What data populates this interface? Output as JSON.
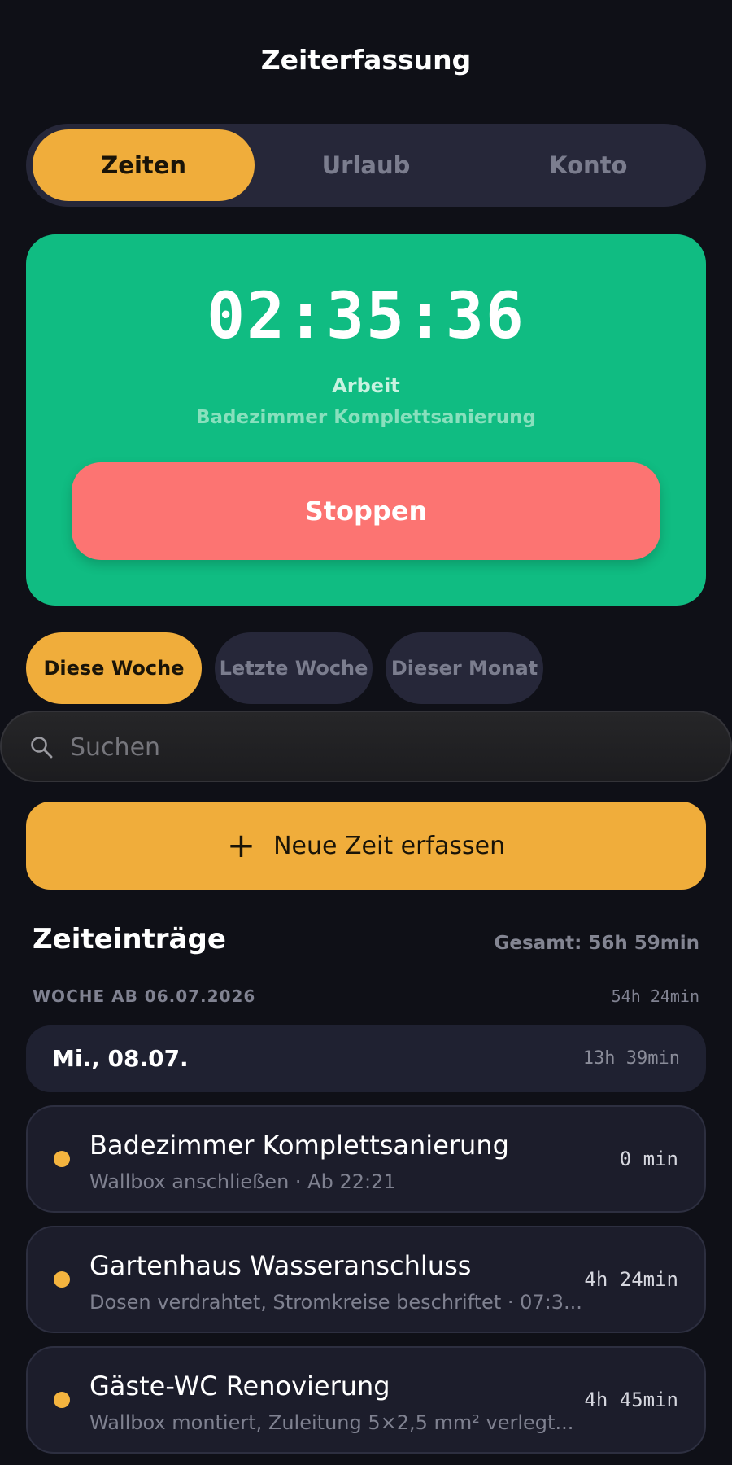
{
  "header": {
    "title": "Zeiterfassung"
  },
  "tabs": [
    {
      "label": "Zeiten",
      "active": true
    },
    {
      "label": "Urlaub",
      "active": false
    },
    {
      "label": "Konto",
      "active": false
    }
  ],
  "timer": {
    "elapsed": "02:35:36",
    "activity": "Arbeit",
    "project": "Badezimmer Komplettsanierung",
    "stop_label": "Stoppen",
    "card_color": "#10bc82",
    "stop_color": "#fc7472"
  },
  "filters": [
    {
      "label": "Diese Woche",
      "active": true
    },
    {
      "label": "Letzte Woche",
      "active": false
    },
    {
      "label": "Dieser Monat",
      "active": false
    }
  ],
  "search": {
    "placeholder": "Suchen",
    "value": ""
  },
  "add_button": {
    "icon": "plus-icon",
    "label": "Neue Zeit erfassen"
  },
  "entries_section": {
    "title": "Zeiteinträge",
    "total": "Gesamt: 56h 59min",
    "week_label": "WOCHE AB 06.07.2026",
    "week_total": "54h 24min",
    "day_label": "Mi., 08.07.",
    "day_total": "13h 39min",
    "items": [
      {
        "title": "Badezimmer Komplettsanierung",
        "subtitle": "Wallbox anschließen · Ab 22:21",
        "duration": "0 min"
      },
      {
        "title": "Gartenhaus Wasseranschluss",
        "subtitle": "Dosen verdrahtet, Stromkreise beschriftet · 07:3...",
        "duration": "4h 24min"
      },
      {
        "title": "Gäste-WC Renovierung",
        "subtitle": "Wallbox montiert, Zuleitung 5×2,5 mm² verlegt...",
        "duration": "4h 45min"
      }
    ]
  },
  "colors": {
    "accent": "#f0ad3b",
    "background": "#0f1017",
    "surface": "#262739",
    "entry_dot": "#f4b43f"
  }
}
